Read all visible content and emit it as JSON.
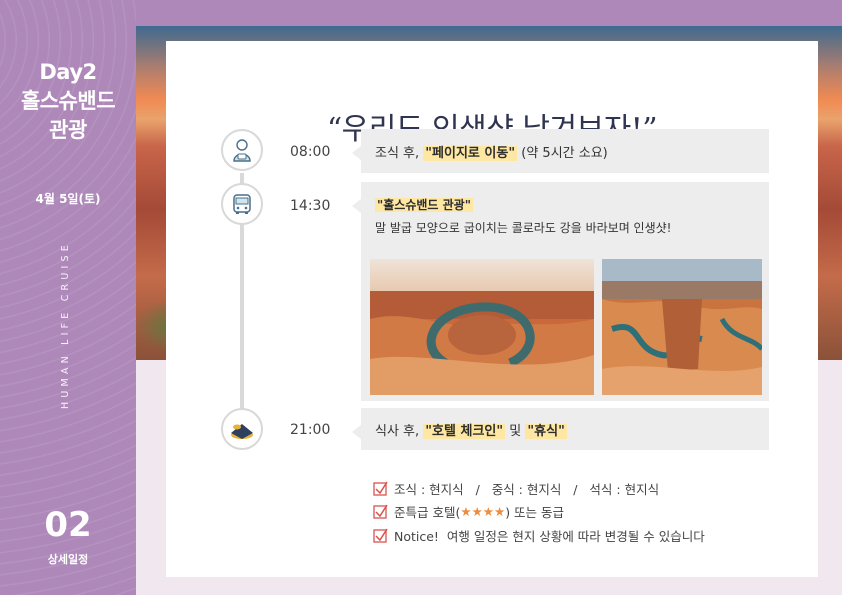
{
  "sidebar": {
    "day": "Day2",
    "title_line1": "홀스슈밴드",
    "title_line2": "관광",
    "date": "4월 5일(토)",
    "tagline": "HUMAN LIFE CRUISE",
    "page_number": "02",
    "page_label": "상세일정"
  },
  "headline": "“우리도 인생샷 남겨보자!”",
  "schedule": [
    {
      "time": "08:00",
      "icon": "person-eating-icon",
      "pre": "조식 후, ",
      "highlight": "\"페이지로 이동\"",
      "post": " (약 5시간 소요)"
    },
    {
      "time": "14:30",
      "icon": "bus-icon",
      "highlight": "\"홀스슈밴드 관광\"",
      "desc": "말 발굽 모양으로 굽이치는 콜로라도 강을 바라보며 인생샷!"
    },
    {
      "time": "21:00",
      "icon": "bed-icon",
      "pre": "식사 후, ",
      "highlight": "\"호텔 체크인\"",
      "mid": " 및 ",
      "highlight2": "\"휴식\""
    }
  ],
  "notes": {
    "meals": "조식 : 현지식   /   중식 : 현지식   /   석식 : 현지식",
    "hotel_pre": "준특급 호텔(",
    "hotel_stars": "★★★★",
    "hotel_post": ") 또는 동급",
    "notice": "Notice!  여행 일정은 현지 상황에 따라 변경될 수 있습니다"
  },
  "colors": {
    "sidebar": "#ad88b9",
    "highlight": "#fde7a3",
    "checkbox": "#d9534f",
    "headline": "#2f3450"
  }
}
